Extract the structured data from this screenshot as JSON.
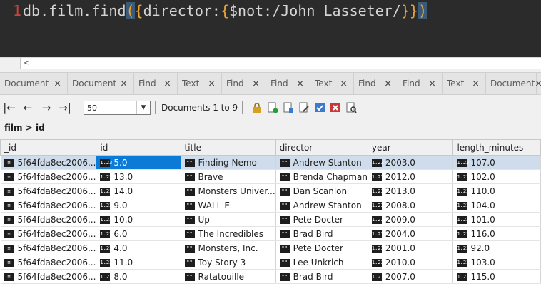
{
  "editor": {
    "line_number": "1",
    "code_prefix": "db.film.find",
    "open_paren": "(",
    "open_brace": "{",
    "key": "director:",
    "inner_open": "{",
    "inner": "$not:/John Lasseter/",
    "inner_close": "}",
    "close_brace": "}",
    "close_paren": ")"
  },
  "hscroll": {
    "left_arrow": "<"
  },
  "tabs": [
    {
      "label": "Document",
      "close": "×"
    },
    {
      "label": "Document",
      "close": "×"
    },
    {
      "label": "Find",
      "close": "×"
    },
    {
      "label": "Text",
      "close": "×"
    },
    {
      "label": "Find",
      "close": "×"
    },
    {
      "label": "Find",
      "close": "×"
    },
    {
      "label": "Text",
      "close": "×"
    },
    {
      "label": "Find",
      "close": "×"
    },
    {
      "label": "Find",
      "close": "×"
    },
    {
      "label": "Text",
      "close": "×"
    },
    {
      "label": "Document",
      "close": "×"
    }
  ],
  "toolbar": {
    "first": "|←",
    "prev": "←",
    "next": "→",
    "last": "→|",
    "page_size": "50",
    "dropdown": "▼",
    "documents_label": "Documents 1 to 9"
  },
  "breadcrumb": {
    "db": "film",
    "sep": ">",
    "field": "id"
  },
  "columns": [
    "_id",
    "id",
    "title",
    "director",
    "year",
    "length_minutes"
  ],
  "type_icons": {
    "doc": "≡",
    "num": "1.23",
    "str": "\"\""
  },
  "rows": [
    [
      "5f64fda8ec2006...",
      "5.0",
      "Finding Nemo",
      "Andrew Stanton",
      "2003.0",
      "107.0"
    ],
    [
      "5f64fda8ec2006...",
      "13.0",
      "Brave",
      "Brenda Chapman",
      "2012.0",
      "102.0"
    ],
    [
      "5f64fda8ec2006...",
      "14.0",
      "Monsters Univer...",
      "Dan Scanlon",
      "2013.0",
      "110.0"
    ],
    [
      "5f64fda8ec2006...",
      "9.0",
      "WALL-E",
      "Andrew Stanton",
      "2008.0",
      "104.0"
    ],
    [
      "5f64fda8ec2006...",
      "10.0",
      "Up",
      "Pete Docter",
      "2009.0",
      "101.0"
    ],
    [
      "5f64fda8ec2006...",
      "6.0",
      "The Incredibles",
      "Brad Bird",
      "2004.0",
      "116.0"
    ],
    [
      "5f64fda8ec2006...",
      "4.0",
      "Monsters, Inc.",
      "Pete Docter",
      "2001.0",
      "92.0"
    ],
    [
      "5f64fda8ec2006...",
      "11.0",
      "Toy Story 3",
      "Lee Unkrich",
      "2010.0",
      "103.0"
    ],
    [
      "5f64fda8ec2006...",
      "8.0",
      "Ratatouille",
      "Brad Bird",
      "2007.0",
      "115.0"
    ]
  ],
  "colors": {
    "selected_row": "#cfdceb",
    "current_cell": "#0b7bd7",
    "editor_bg": "#2b2b2b",
    "bracket": "#e8a33a"
  }
}
